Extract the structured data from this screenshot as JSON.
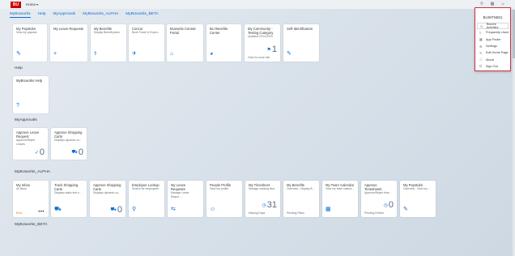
{
  "shell": {
    "logo": "BU",
    "home_title": "Home",
    "caret": "▾",
    "search_icon": "⚲",
    "copilot_icon": "▦",
    "me_icon": "☺"
  },
  "tabs": [
    "MyBUworks",
    "Help",
    "MyApprovals",
    "MyBUworks_ALPHA",
    "MyBUworks_BETA"
  ],
  "sections": {
    "help": "Help",
    "approvals": "MyApprovals",
    "alpha": "MyBUworks_ALPHA",
    "beta": "MyBUworks_BETA"
  },
  "tiles_main": [
    {
      "title": "My Paystubs",
      "sub": "View my paystub",
      "icon": "✎"
    },
    {
      "title": "My Leave Requests",
      "sub": "",
      "icon": "+"
    },
    {
      "title": "My Benefits",
      "sub": "Display Benefit plans",
      "icon": "⚕"
    },
    {
      "title": "Concur",
      "sub": "Book Travel & Expen...",
      "icon": "✈"
    },
    {
      "title": "BUworks Central Portal",
      "sub": "",
      "icon": "⌂"
    },
    {
      "title": "BU Benefits Center",
      "sub": "",
      "icon": "◕"
    },
    {
      "title": "My Community - Testing Category",
      "sub": "Updated 07/01/2020",
      "footer": "Click for more info",
      "num": "1",
      "num_icon": "⚑"
    },
    {
      "title": "Self-Identification",
      "sub": "",
      "icon": "✎"
    }
  ],
  "tiles_help": [
    {
      "title": "MyBUworks Help",
      "sub": "",
      "icon": "?"
    }
  ],
  "tiles_approvals": [
    {
      "title": "Approve Leave Request",
      "sub": "Approve/Reject Leaves",
      "num": "0",
      "num_icon": "✓"
    },
    {
      "title": "Approve Shopping Carts",
      "sub": "Displays dynamic co...",
      "num": "0",
      "num_icon": "⛟"
    }
  ],
  "tiles_alpha": [
    {
      "title": "My Inbox",
      "sub": "All Items",
      "footer": "Error",
      "footer_orange": true,
      "dots": "•••"
    },
    {
      "title": "Track Shopping Carts",
      "sub": "Displays static text u...",
      "icon": "⛟"
    },
    {
      "title": "Approve Shopping Carts",
      "sub": "Displays dynamic co...",
      "num": "0",
      "num_icon": "⛟"
    },
    {
      "title": "Employee Lookup",
      "sub": "Search for employees",
      "icon": "⚲"
    },
    {
      "title": "My Leave Requests",
      "sub": "Manage Leave Reque...",
      "icon": "⇆"
    },
    {
      "title": "People Profile",
      "sub": "View my profile",
      "icon": "☺"
    },
    {
      "title": "My Timesheet",
      "sub": "Manage working time",
      "footer": "Missing Days",
      "num": "31",
      "num_icon": "◷"
    },
    {
      "title": "My Benefits",
      "sub": "Overview - Display B...",
      "footer": "Pending Plans",
      "icon": "⚕"
    },
    {
      "title": "My Team Calendar",
      "sub": "View my team calend...",
      "icon": "▦"
    },
    {
      "title": "Approve Timesheets",
      "sub": "Approve/Reject time...",
      "footer": "Pending Entries",
      "num": "0",
      "num_icon": "◷"
    },
    {
      "title": "My Paystubs",
      "sub": "Overview - View my ...",
      "icon": "✎"
    }
  ],
  "me_area": {
    "user": "BUWTN801",
    "items": [
      {
        "label": "Recent Activities",
        "icon": "◷"
      },
      {
        "label": "Frequently Used",
        "icon": "≡"
      },
      {
        "label": "App Finder",
        "icon": "▦"
      },
      {
        "label": "Settings",
        "icon": "⚙"
      },
      {
        "label": "Edit Home Page",
        "icon": "✎"
      },
      {
        "label": "About",
        "icon": "ⓘ"
      },
      {
        "label": "Sign Out",
        "icon": "⏻"
      }
    ]
  }
}
